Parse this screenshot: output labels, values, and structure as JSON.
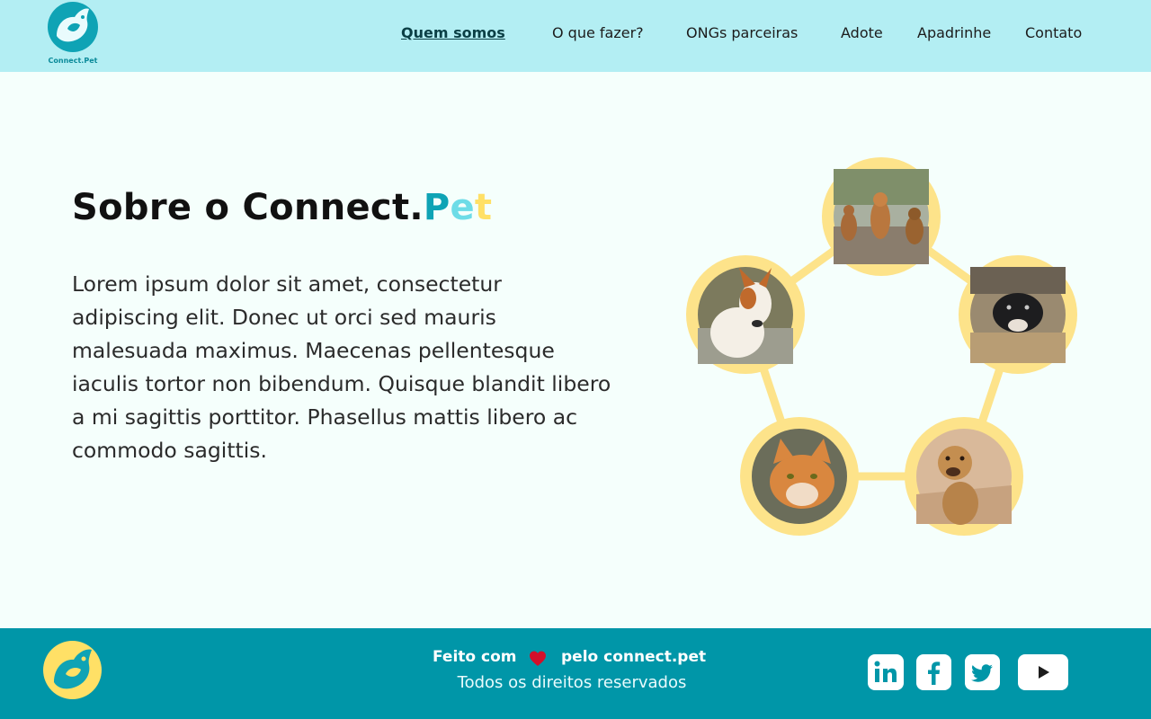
{
  "header": {
    "logo_caption": "Connect.Pet",
    "nav": [
      {
        "label": "Quem somos",
        "active": true
      },
      {
        "label": "O que fazer?",
        "active": false
      },
      {
        "label": "ONGs parceiras",
        "active": false
      },
      {
        "label": "Adote",
        "active": false
      },
      {
        "label": "Apadrinhe",
        "active": false
      },
      {
        "label": "Contato",
        "active": false
      }
    ]
  },
  "main": {
    "title_prefix": "Sobre o Connect.",
    "title_p": "P",
    "title_e": "e",
    "title_t": "t",
    "body": "Lorem ipsum dolor sit amet, consectetur adipiscing elit. Donec ut orci sed mauris malesuada maximus. Maecenas pellentesque iaculis tortor non bibendum. Quisque blandit libero a mi sagittis porttitor. Phasellus mattis libero ac commodo sagittis.",
    "photos": [
      {
        "icon": "three-dogs-photo"
      },
      {
        "icon": "black-dog-photo"
      },
      {
        "icon": "brown-dog-photo"
      },
      {
        "icon": "orange-cat-photo"
      },
      {
        "icon": "white-dog-photo"
      }
    ]
  },
  "footer": {
    "made_with": "Feito com",
    "made_by": "pelo connect.pet",
    "rights": "Todos os direitos reservados",
    "social": [
      "linkedin-icon",
      "facebook-icon",
      "twitter-icon",
      "youtube-icon"
    ]
  },
  "colors": {
    "header_bg": "#b3eef3",
    "page_bg": "#f5fffc",
    "footer_bg": "#0096a8",
    "accent_teal": "#0fa3b5",
    "accent_light": "#6ddce7",
    "accent_yellow": "#ffe066",
    "ring_yellow": "#fde38a",
    "heart_red": "#d3102a"
  }
}
